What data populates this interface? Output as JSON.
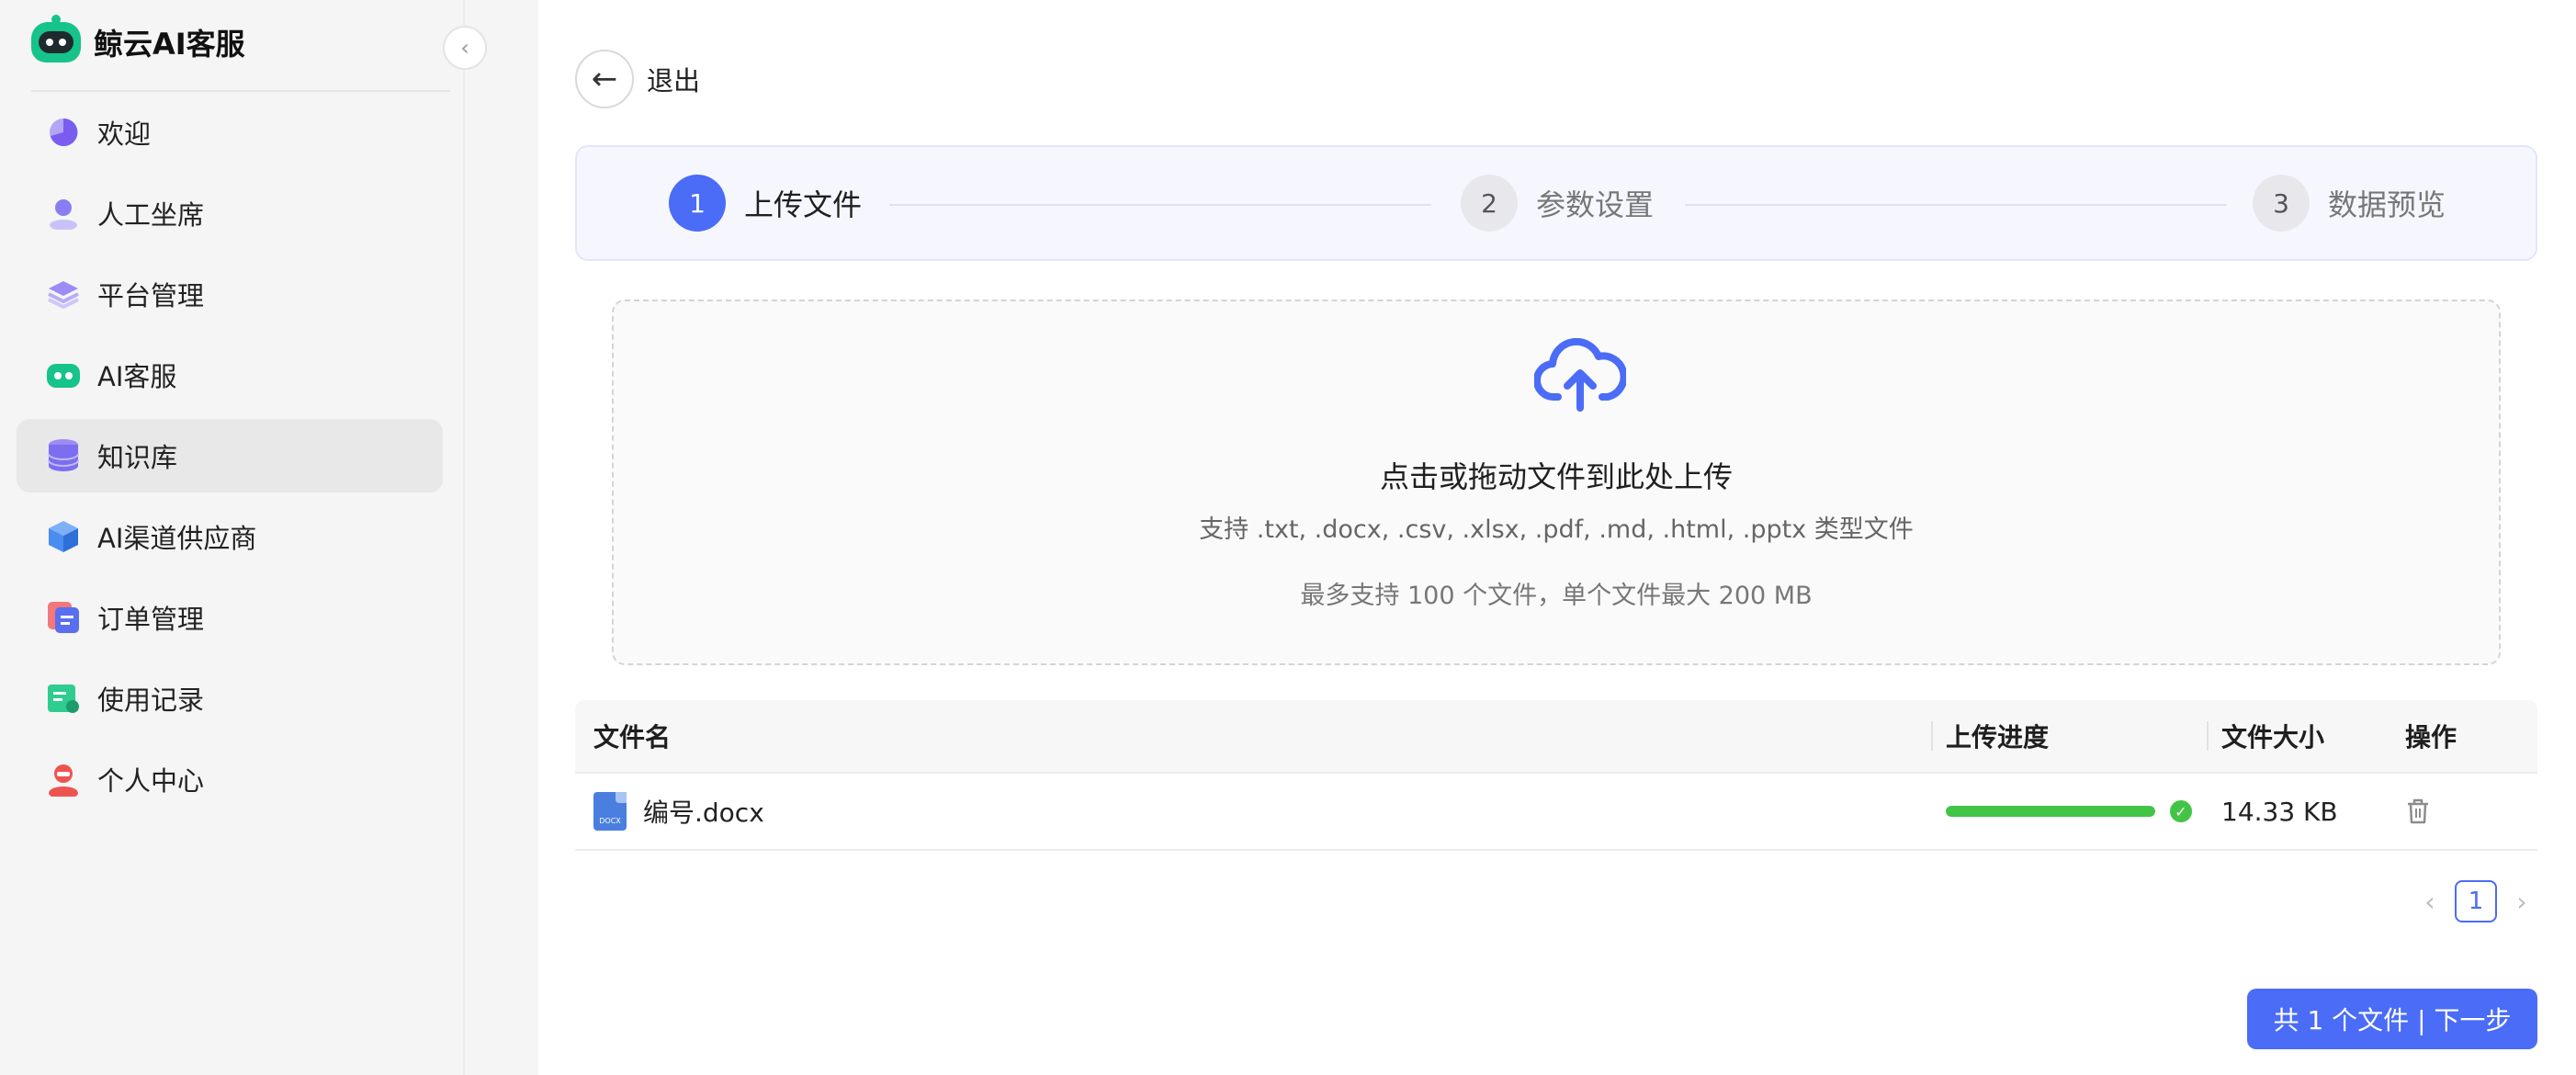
{
  "brand": {
    "title": "鲸云AI客服"
  },
  "colors": {
    "accent": "#4a6cf7",
    "success": "#42c447",
    "brand": "#16c38a"
  },
  "sidebar": {
    "items": [
      {
        "label": "欢迎",
        "icon": "pie-chart-icon",
        "color": "#7b5cf0"
      },
      {
        "label": "人工坐席",
        "icon": "user-icon",
        "color": "#8a7cf3"
      },
      {
        "label": "平台管理",
        "icon": "layers-icon",
        "color": "#9b8cf5"
      },
      {
        "label": "AI客服",
        "icon": "robot-icon",
        "color": "#16c38a"
      },
      {
        "label": "知识库",
        "icon": "database-icon",
        "color": "#7b6ef0"
      },
      {
        "label": "AI渠道供应商",
        "icon": "cube-icon",
        "color": "#4a8cf0"
      },
      {
        "label": "订单管理",
        "icon": "order-icon",
        "color": "#e8504f"
      },
      {
        "label": "使用记录",
        "icon": "record-icon",
        "color": "#2ecc8f"
      },
      {
        "label": "个人中心",
        "icon": "avatar-icon",
        "color": "#ef5350"
      }
    ],
    "active_index": 4
  },
  "header": {
    "back_label": "退出"
  },
  "steps": [
    {
      "num": "1",
      "label": "上传文件",
      "state": "active"
    },
    {
      "num": "2",
      "label": "参数设置",
      "state": "inactive"
    },
    {
      "num": "3",
      "label": "数据预览",
      "state": "inactive"
    }
  ],
  "dropzone": {
    "title": "点击或拖动文件到此处上传",
    "supported": "支持 .txt, .docx, .csv, .xlsx, .pdf, .md, .html, .pptx 类型文件",
    "limit": "最多支持 100 个文件，单个文件最大 200 MB"
  },
  "table": {
    "headers": {
      "name": "文件名",
      "progress": "上传进度",
      "size": "文件大小",
      "op": "操作"
    },
    "rows": [
      {
        "name": "编号.docx",
        "progress": 1.0,
        "size": "14.33 KB",
        "file_icon_text": "DOCX"
      }
    ]
  },
  "pagination": {
    "current": "1",
    "prev": "‹",
    "next": "›"
  },
  "footer": {
    "next_label": "共 1 个文件 | 下一步"
  }
}
